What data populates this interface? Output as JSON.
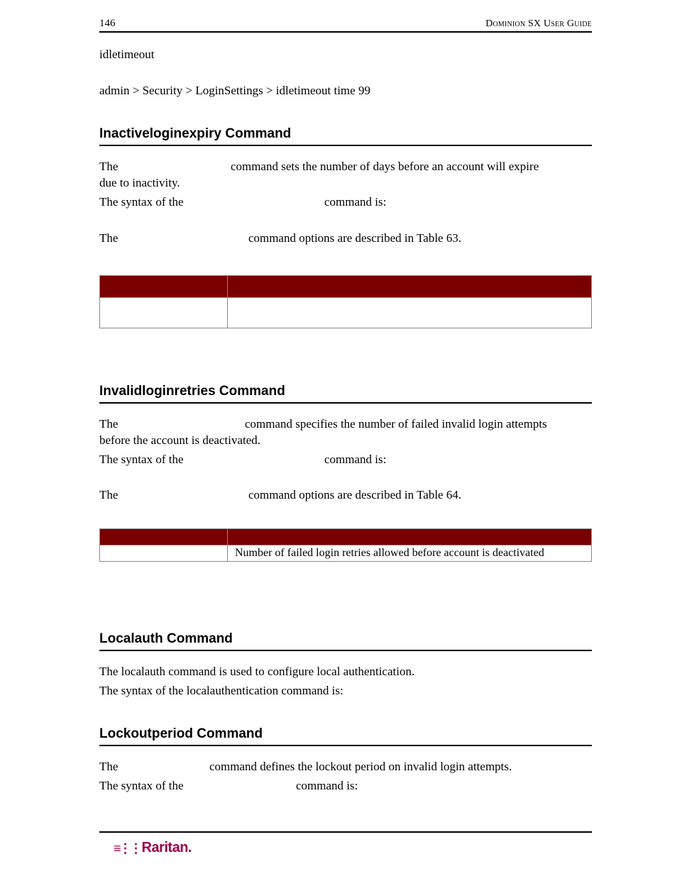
{
  "header": {
    "page_number": "146",
    "doc_title": "Dominion SX User Guide"
  },
  "intro": {
    "line1": "idletimeout",
    "line2": "admin > Security > LoginSettings > idletimeout time 99"
  },
  "sections": {
    "inactive": {
      "heading": "Inactiveloginexpiry Command",
      "p1a": "The",
      "p1b": "command sets the number of days before an account will expire",
      "p1c": "due to inactivity.",
      "p2a": "The syntax of the",
      "p2b": "command is:",
      "p3a": "The",
      "p3b": "command options are described in Table 63.",
      "table": {
        "h1": "",
        "h2": "",
        "r1c1": "",
        "r1c2": ""
      }
    },
    "invalid": {
      "heading": "Invalidloginretries  Command",
      "p1a": "The",
      "p1b": "command specifies the number of failed invalid login attempts",
      "p1c": "before the account is deactivated.",
      "p2a": "The syntax of the",
      "p2b": "command is:",
      "p3a": "The",
      "p3b": "command options are described in Table 64.",
      "table": {
        "h1": "",
        "h2": "",
        "r1c1": "",
        "r1c2": "Number of failed login retries allowed before account is deactivated"
      }
    },
    "localauth": {
      "heading": "Localauth Command",
      "p1": "The localauth command is used to configure local authentication.",
      "p2": "The syntax of the localauthentication command is:"
    },
    "lockout": {
      "heading": "Lockoutperiod  Command",
      "p1a": "The",
      "p1b": "command defines the lockout period on invalid login attempts.",
      "p2a": "The syntax of the",
      "p2b": "command is:"
    }
  },
  "footer": {
    "brand": "Raritan."
  }
}
